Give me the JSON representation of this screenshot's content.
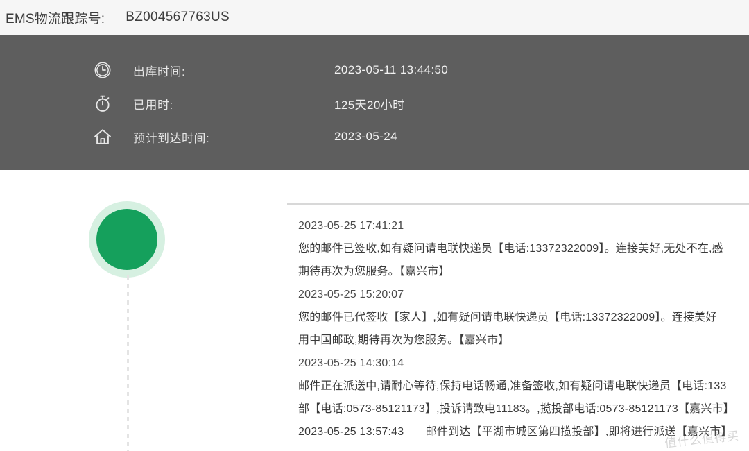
{
  "header": {
    "label": "EMS物流跟踪号:",
    "tracking_number": "BZ004567763US"
  },
  "summary": {
    "rows": [
      {
        "icon": "clock-icon",
        "label": "出库时间:",
        "value": "2023-05-11 13:44:50"
      },
      {
        "icon": "stopwatch-icon",
        "label": "已用时:",
        "value": "125天20小时"
      },
      {
        "icon": "home-icon",
        "label": "预计到达时间:",
        "value": "2023-05-24"
      }
    ]
  },
  "timeline": {
    "status_color": "#15a05c",
    "halo_color": "#d6f0e1",
    "events": [
      {
        "time": "2023-05-25 17:41:21",
        "line1": "您的邮件已签收,如有疑问请电联快递员【电话:13372322009】。连接美好,无处不在,感",
        "line2": "期待再次为您服务。【嘉兴市】"
      },
      {
        "time": "2023-05-25 15:20:07",
        "line1": "您的邮件已代签收【家人】,如有疑问请电联快递员【电话:13372322009】。连接美好",
        "line2": "用中国邮政,期待再次为您服务。【嘉兴市】"
      },
      {
        "time": "2023-05-25 14:30:14",
        "line1": "邮件正在派送中,请耐心等待,保持电话畅通,准备签收,如有疑问请电联快递员【电话:133",
        "line2": "部【电话:0573-85121173】,投诉请致电11183。,揽投部电话:0573-85121173【嘉兴市】"
      },
      {
        "time": "2023-05-25 13:57:43",
        "inline": "邮件到达【平湖市城区第四揽投部】,即将进行派送【嘉兴市】"
      }
    ]
  },
  "watermark": {
    "text": "值什么值得买"
  }
}
